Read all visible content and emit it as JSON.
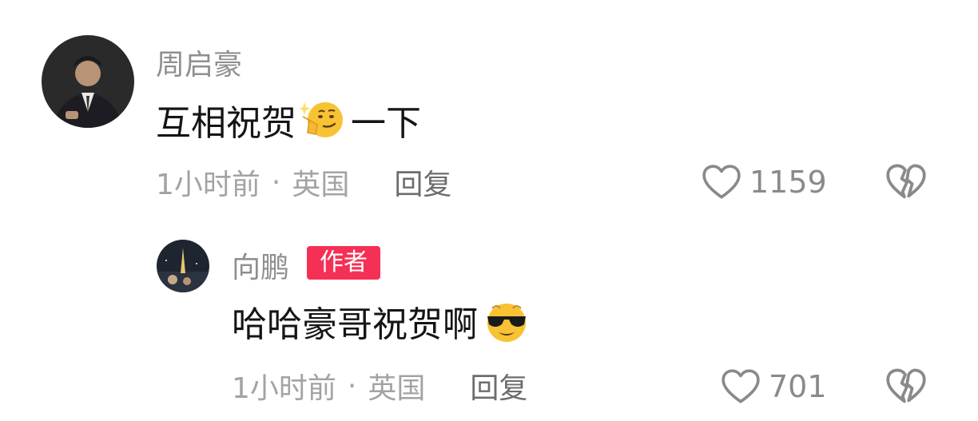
{
  "comments": [
    {
      "username": "周启豪",
      "text_before": "互相祝贺",
      "emoji": "thinking-smirk-emoji",
      "text_after": "一下",
      "time": "1小时前",
      "separator": "·",
      "location": "英国",
      "reply_label": "回复",
      "likes": "1159",
      "reply": {
        "username": "向鹏",
        "badge": "作者",
        "text_before": "哈哈豪哥祝贺啊",
        "emoji": "sunglasses-emoji",
        "text_after": "",
        "time": "1小时前",
        "separator": "·",
        "location": "英国",
        "reply_label": "回复",
        "likes": "701"
      }
    }
  ],
  "colors": {
    "badge": "#f53055",
    "username": "#8f8f8f",
    "meta": "#a3a3a3",
    "icon": "#8a8a8a"
  }
}
